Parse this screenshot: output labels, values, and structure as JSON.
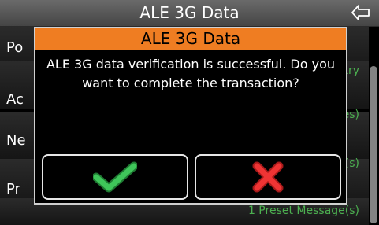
{
  "header": {
    "title": "ALE 3G Data",
    "back_icon": "back-arrow-icon"
  },
  "list": {
    "items": [
      {
        "label": "Po",
        "value": ""
      },
      {
        "label": "Ac",
        "value": "try"
      },
      {
        "label": "Ne",
        "value": "es)"
      },
      {
        "label": "Pr",
        "value": "(s)"
      },
      {
        "label": "",
        "value": "1 Preset Message(s)"
      }
    ]
  },
  "dialog": {
    "title": "ALE 3G Data",
    "message": "ALE 3G data verification is successful. Do you want to complete the transaction?",
    "confirm_icon": "checkmark-icon",
    "cancel_icon": "x-icon",
    "colors": {
      "title_bg": "#ef7d22",
      "check": "#2eb84a",
      "cross": "#e52b2b"
    }
  }
}
